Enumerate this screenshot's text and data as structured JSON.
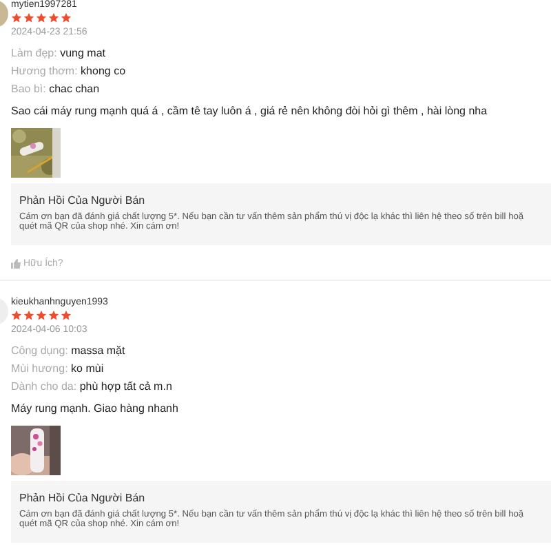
{
  "reviews": [
    {
      "username": "mytien1997281",
      "stars": 5,
      "date": "2024-04-23 21:56",
      "attributes": [
        {
          "label": "Làm đẹp:",
          "value": "vung mat"
        },
        {
          "label": "Hương thơm:",
          "value": "khong co"
        },
        {
          "label": "Bao bì:",
          "value": "chac chan"
        }
      ],
      "comment": "Sao cái máy rung mạnh quá á , cầm tê tay luôn á , giá rẻ nên không đòi hỏi gì thêm , hài lòng nha",
      "reply": {
        "title": "Phản Hồi Của Người Bán",
        "lines": [
          "Cám ơn bạn đã đánh giá chất lượng 5*. Nếu bạn cần tư vấn thêm sản phẩm thú vị độc lạ khác thì liên hệ theo số trên bill hoặ",
          "quét mã QR của shop nhé. Xin cám ơn!"
        ]
      },
      "helpful": "Hữu Ích?"
    },
    {
      "username": "kieukhanhnguyen1993",
      "stars": 5,
      "date": "2024-04-06 10:03",
      "attributes": [
        {
          "label": "Công dụng:",
          "value": "massa mặt"
        },
        {
          "label": "Mùi hương:",
          "value": "ko mùi"
        },
        {
          "label": "Dành cho da:",
          "value": "phù hợp tất cả m.n"
        }
      ],
      "comment": "Máy rung mạnh. Giao hàng nhanh",
      "reply": {
        "title": "Phản Hồi Của Người Bán",
        "lines": [
          "Cám ơn bạn đã đánh giá chất lượng 5*. Nếu bạn cần tư vấn thêm sản phẩm thú vị độc lạ khác thì liên hệ theo số trên bill hoặ",
          "quét mã QR của shop nhé. Xin cám ơn!"
        ]
      }
    }
  ]
}
